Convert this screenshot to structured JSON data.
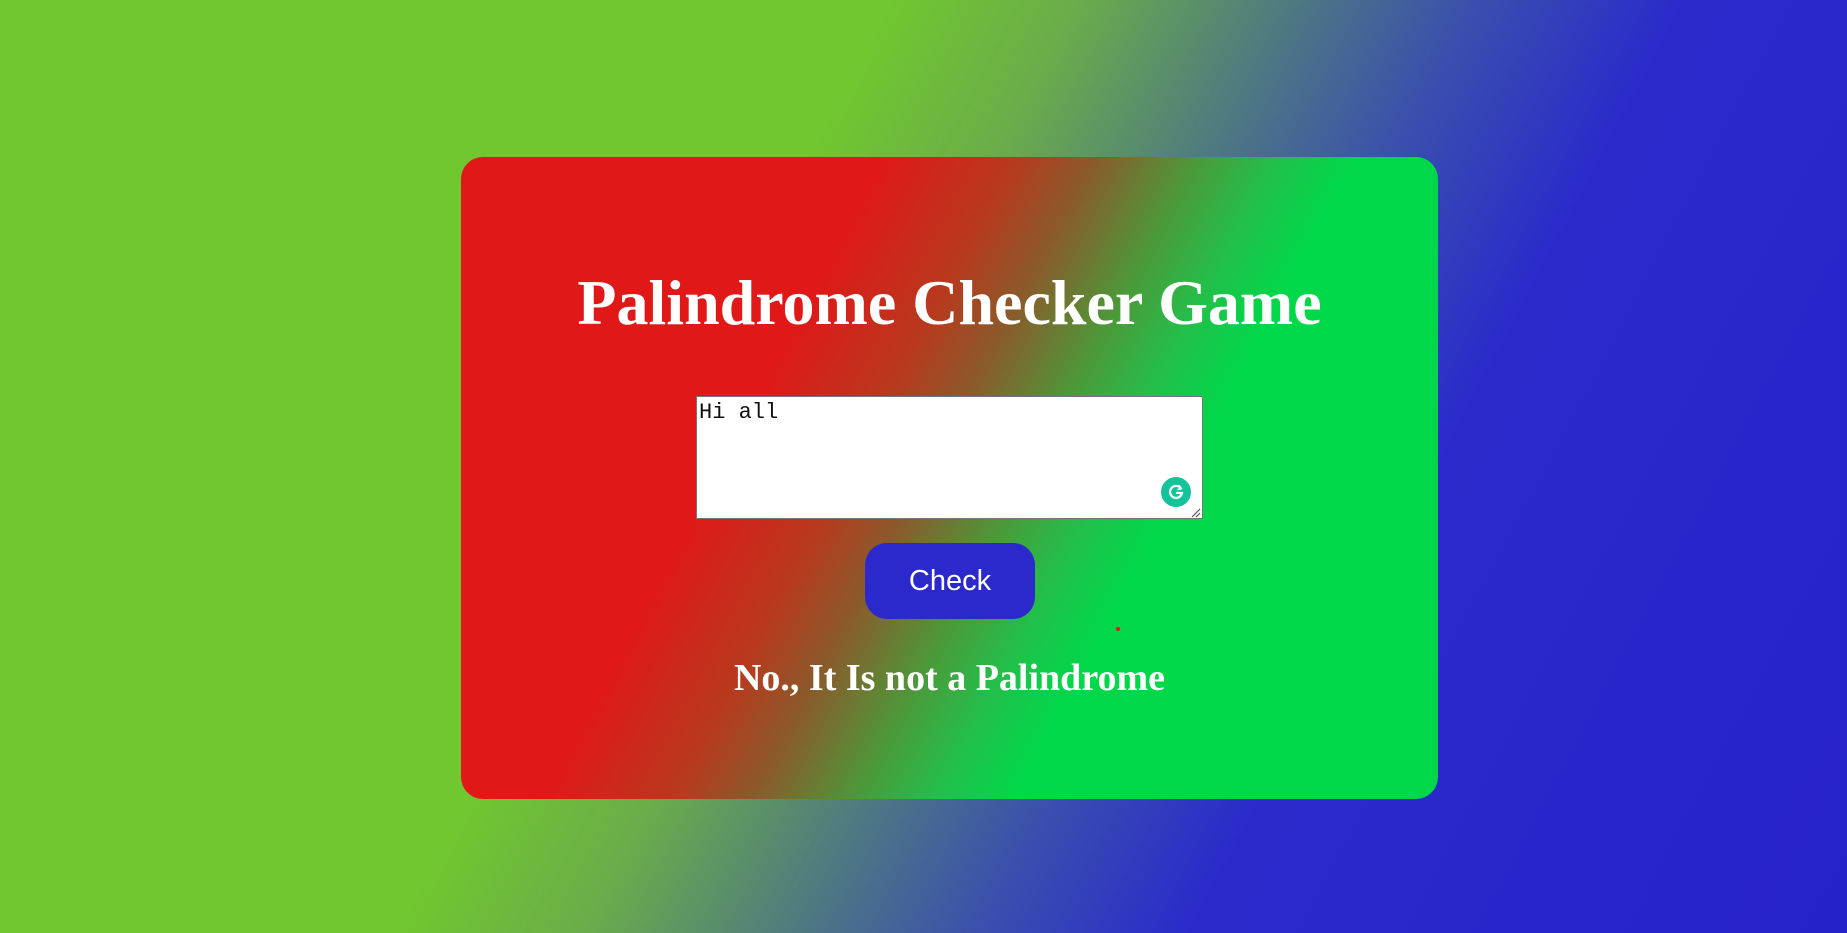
{
  "game": {
    "title": "Palindrome Checker Game",
    "input_value": "Hi all",
    "check_label": "Check",
    "result_text": "No., It Is not a Palindrome"
  },
  "colors": {
    "background_start": "#71c72f",
    "background_end": "#2622c9",
    "card_start": "#e01818",
    "card_end": "#00d84a",
    "button": "#2b28cc",
    "grammarly": "#15c39a",
    "dot": "#e01818"
  },
  "icons": {
    "grammarly": "grammarly-icon",
    "resize": "resize-handle-icon"
  }
}
